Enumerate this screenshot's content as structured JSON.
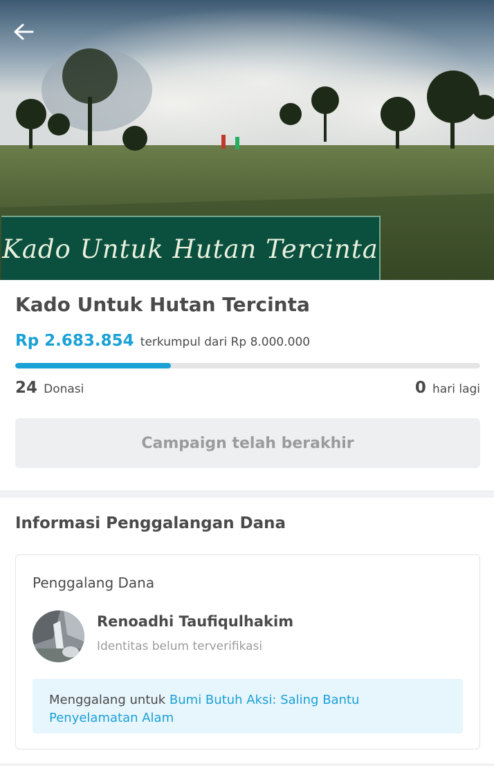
{
  "campaign": {
    "banner_text": "Kado Untuk Hutan Tercinta",
    "title": "Kado Untuk Hutan Tercinta",
    "raised": "Rp 2.683.854",
    "target_text": "terkumpul dari Rp 8.000.000",
    "progress_fraction": 0.335,
    "donations_count": "24",
    "donations_label": "Donasi",
    "days_left": "0",
    "days_label": "hari lagi",
    "status_button": "Campaign telah berakhir"
  },
  "info": {
    "section_title": "Informasi Penggalangan Dana",
    "fundraiser_label": "Penggalang Dana",
    "fundraiser_name": "Renoadhi Taufiqulhakim",
    "fundraiser_status": "Identitas belum terverifikasi",
    "purpose_prefix": "Menggalang untuk",
    "purpose_link": "Bumi Butuh Aksi: Saling Bantu Penyelamatan Alam"
  },
  "colors": {
    "accent": "#1aa1d6",
    "text": "#4a4a4a",
    "muted": "#9b9b9b"
  },
  "icons": {
    "back": "arrow-left-icon"
  }
}
